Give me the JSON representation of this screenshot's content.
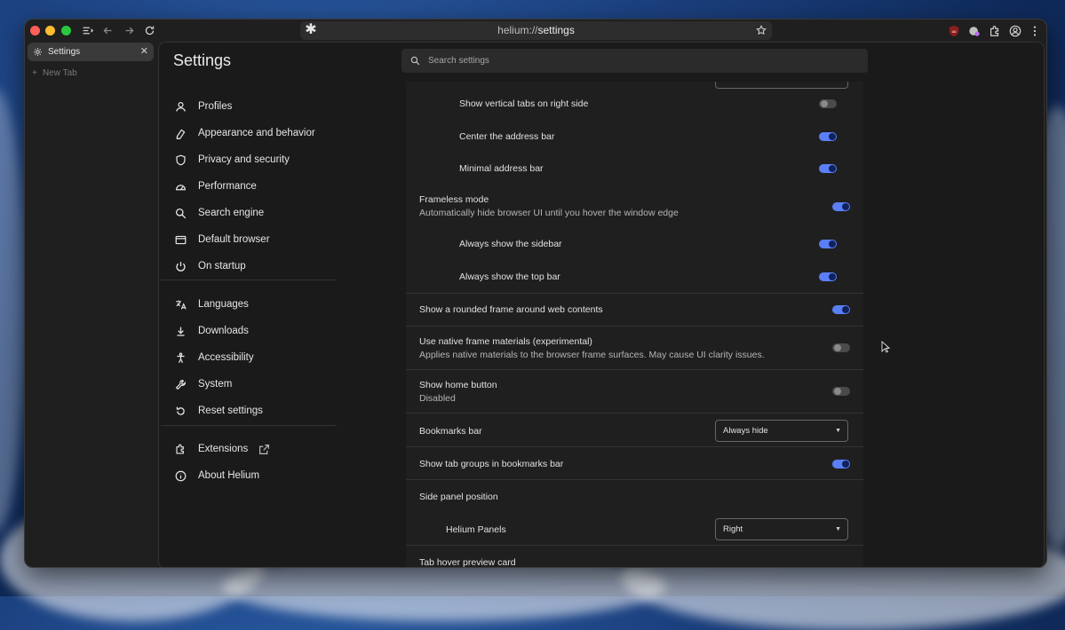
{
  "browser": {
    "url_scheme": "helium://",
    "url_path": "settings",
    "site_icon": "asterisk-icon"
  },
  "tabs": {
    "active_label": "Settings",
    "new_tab_label": "New Tab"
  },
  "settings": {
    "title": "Settings",
    "search_placeholder": "Search settings",
    "nav": [
      {
        "label": "Profiles",
        "icon": "person-icon"
      },
      {
        "label": "Appearance and behavior",
        "icon": "paint-icon"
      },
      {
        "label": "Privacy and security",
        "icon": "shield-icon"
      },
      {
        "label": "Performance",
        "icon": "gauge-icon"
      },
      {
        "label": "Search engine",
        "icon": "search-icon"
      },
      {
        "label": "Default browser",
        "icon": "browser-icon"
      },
      {
        "label": "On startup",
        "icon": "power-icon"
      },
      {
        "label": "Languages",
        "icon": "translate-icon"
      },
      {
        "label": "Downloads",
        "icon": "download-icon"
      },
      {
        "label": "Accessibility",
        "icon": "accessibility-icon"
      },
      {
        "label": "System",
        "icon": "wrench-icon"
      },
      {
        "label": "Reset settings",
        "icon": "reset-icon"
      },
      {
        "label": "Extensions",
        "icon": "puzzle-icon"
      },
      {
        "label": "About Helium",
        "icon": "info-icon"
      }
    ],
    "rows": {
      "vertical_tabs_right": {
        "label": "Show vertical tabs on right side",
        "on": false
      },
      "center_address": {
        "label": "Center the address bar",
        "on": true
      },
      "minimal_address": {
        "label": "Minimal address bar",
        "on": true
      },
      "frameless": {
        "label": "Frameless mode",
        "sub": "Automatically hide browser UI until you hover the window edge",
        "on": true
      },
      "always_sidebar": {
        "label": "Always show the sidebar",
        "on": true
      },
      "always_topbar": {
        "label": "Always show the top bar",
        "on": true
      },
      "rounded_frame": {
        "label": "Show a rounded frame around web contents",
        "on": true
      },
      "native_materials": {
        "label": "Use native frame materials (experimental)",
        "sub": "Applies native materials to the browser frame surfaces. May cause UI clarity issues.",
        "on": false
      },
      "home_button": {
        "label": "Show home button",
        "sub": "Disabled",
        "on": false
      },
      "bookmarks_bar": {
        "label": "Bookmarks bar",
        "value": "Always hide"
      },
      "tab_groups_bookmarks": {
        "label": "Show tab groups in bookmarks bar",
        "on": true
      },
      "side_panel_position": {
        "label": "Side panel position"
      },
      "helium_panels": {
        "label": "Helium Panels",
        "value": "Right"
      },
      "tab_hover_preview": {
        "label": "Tab hover preview card"
      }
    }
  }
}
